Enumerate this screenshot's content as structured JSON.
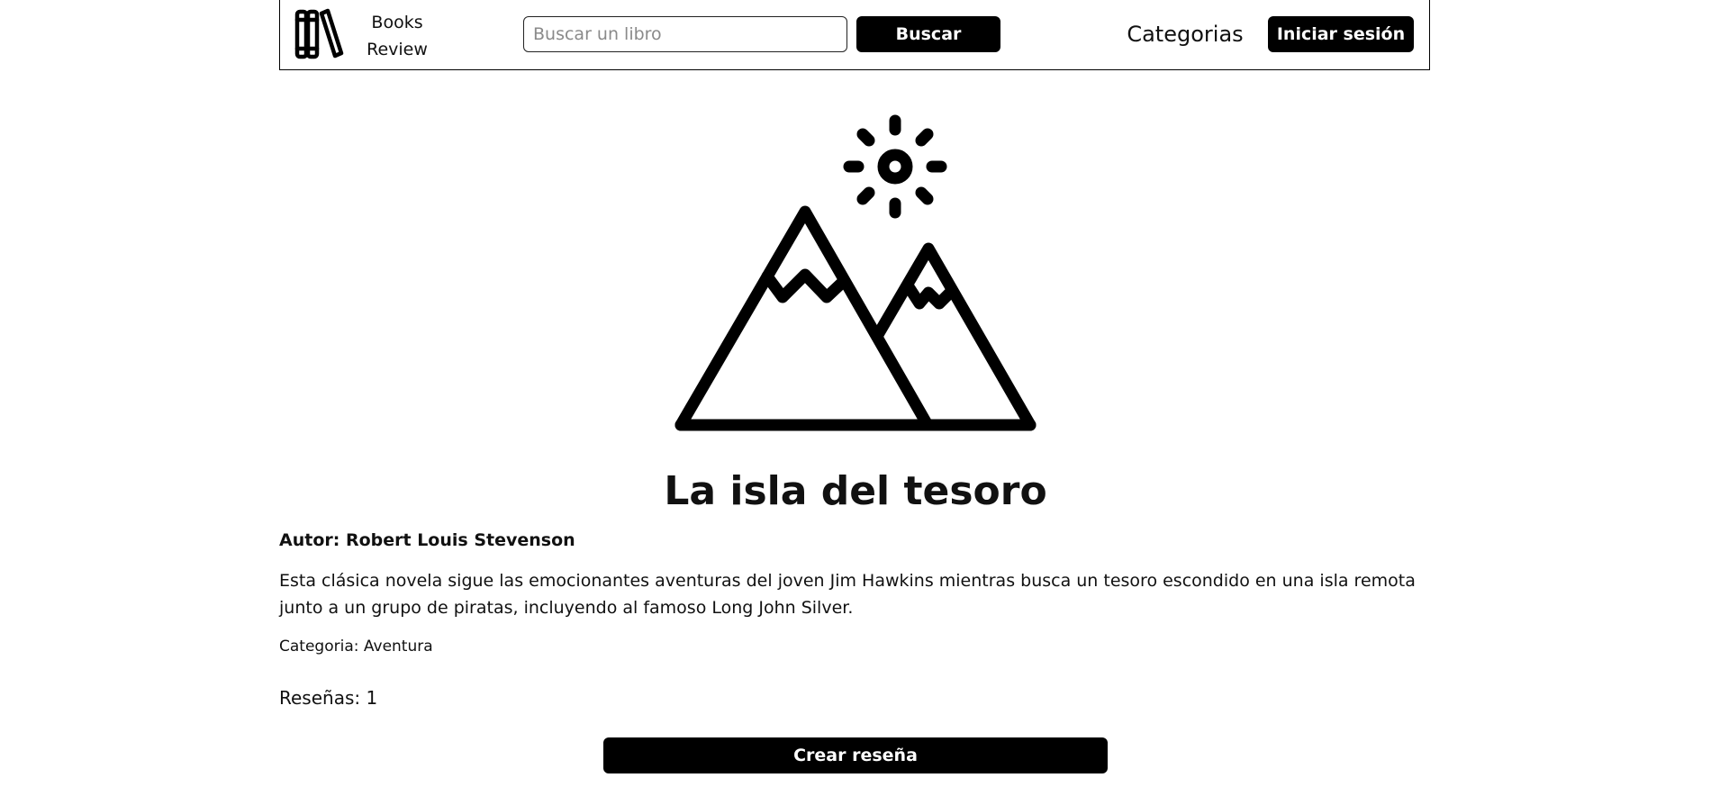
{
  "header": {
    "logo_icon": "books-icon",
    "brand_line1": "Books",
    "brand_line2": "Review",
    "search_placeholder": "Buscar un libro",
    "search_value": "",
    "search_button": "Buscar",
    "categories_link": "Categorias",
    "login_button": "Iniciar sesión"
  },
  "book": {
    "image_icon": "landscape-placeholder-icon",
    "title": "La isla del tesoro",
    "author_label": "Autor: ",
    "author_name": "Robert Louis Stevenson",
    "description": "Esta clásica novela sigue las emocionantes aventuras del joven Jim Hawkins mientras busca un tesoro escondido en una isla remota junto a un grupo de piratas, incluyendo al famoso Long John Silver.",
    "category_label": "Categoria: ",
    "category_value": "Aventura",
    "reviews_label": "Reseñas: ",
    "reviews_count": "1",
    "create_review_button": "Crear reseña"
  },
  "colors": {
    "primary_button": "#000000",
    "button_text": "#ffffff",
    "text": "#111111",
    "background": "#ffffff"
  }
}
